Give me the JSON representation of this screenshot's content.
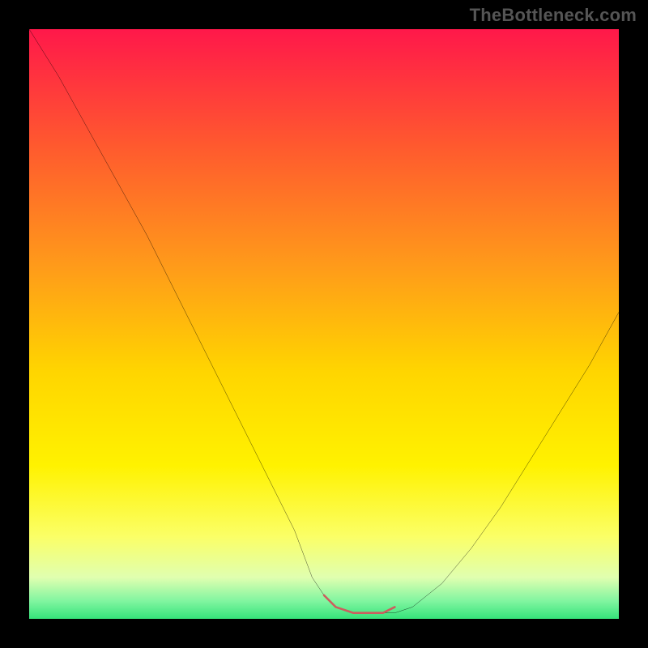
{
  "attribution": "TheBottleneck.com",
  "chart_data": {
    "type": "line",
    "title": "",
    "xlabel": "",
    "ylabel": "",
    "xlim": [
      0,
      100
    ],
    "ylim": [
      0,
      100
    ],
    "series": [
      {
        "name": "bottleneck-curve",
        "x": [
          0,
          5,
          10,
          15,
          20,
          25,
          30,
          35,
          40,
          45,
          48,
          50,
          52,
          55,
          58,
          60,
          62,
          65,
          70,
          75,
          80,
          85,
          90,
          95,
          100
        ],
        "values": [
          100,
          92,
          83,
          74,
          65,
          55,
          45,
          35,
          25,
          15,
          7,
          4,
          2,
          1,
          1,
          1,
          1,
          2,
          6,
          12,
          19,
          27,
          35,
          43,
          52
        ]
      }
    ],
    "highlight": {
      "name": "optimal-zone",
      "x": [
        50,
        52,
        55,
        58,
        60,
        62
      ],
      "values": [
        4,
        2,
        1,
        1,
        1,
        2
      ],
      "color": "#cc5e5e"
    },
    "background_gradient": {
      "stops": [
        {
          "offset": 0.0,
          "color": "#ff184a"
        },
        {
          "offset": 0.2,
          "color": "#ff5a2e"
        },
        {
          "offset": 0.4,
          "color": "#ff9a1a"
        },
        {
          "offset": 0.58,
          "color": "#ffd500"
        },
        {
          "offset": 0.74,
          "color": "#fff200"
        },
        {
          "offset": 0.86,
          "color": "#fbff66"
        },
        {
          "offset": 0.93,
          "color": "#e0ffb0"
        },
        {
          "offset": 0.97,
          "color": "#80f5a0"
        },
        {
          "offset": 1.0,
          "color": "#35e37a"
        }
      ]
    }
  }
}
